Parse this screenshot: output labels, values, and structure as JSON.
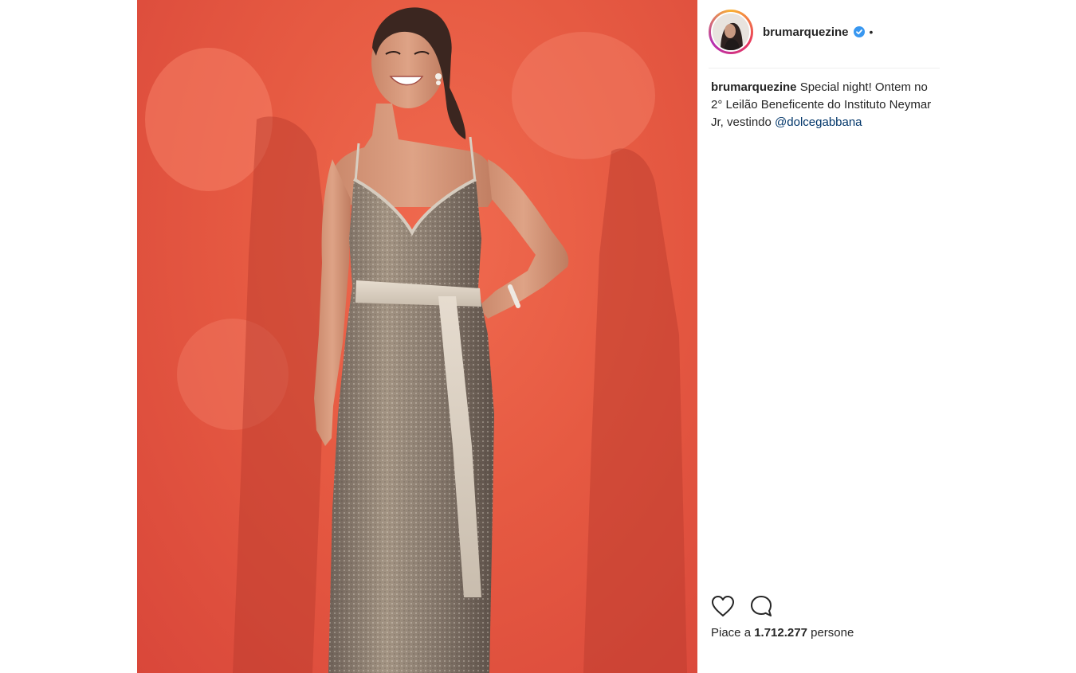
{
  "post": {
    "username": "brumarquezine",
    "separator": "•",
    "caption_user": "brumarquezine",
    "caption_text": " Special night! Ontem no 2° Leilão Beneficente do Instituto Neymar Jr, vestindo ",
    "caption_mention": "@dolcegabbana",
    "likes_prefix": "Piace a ",
    "likes_count": "1.712.277",
    "likes_suffix": " persone"
  },
  "icons": {
    "verified": "verified-badge-icon",
    "like": "heart-icon",
    "comment": "comment-bubble-icon"
  },
  "colors": {
    "background": "#e65a42",
    "verified": "#3897f0",
    "mention": "#003569",
    "text": "#262626"
  }
}
